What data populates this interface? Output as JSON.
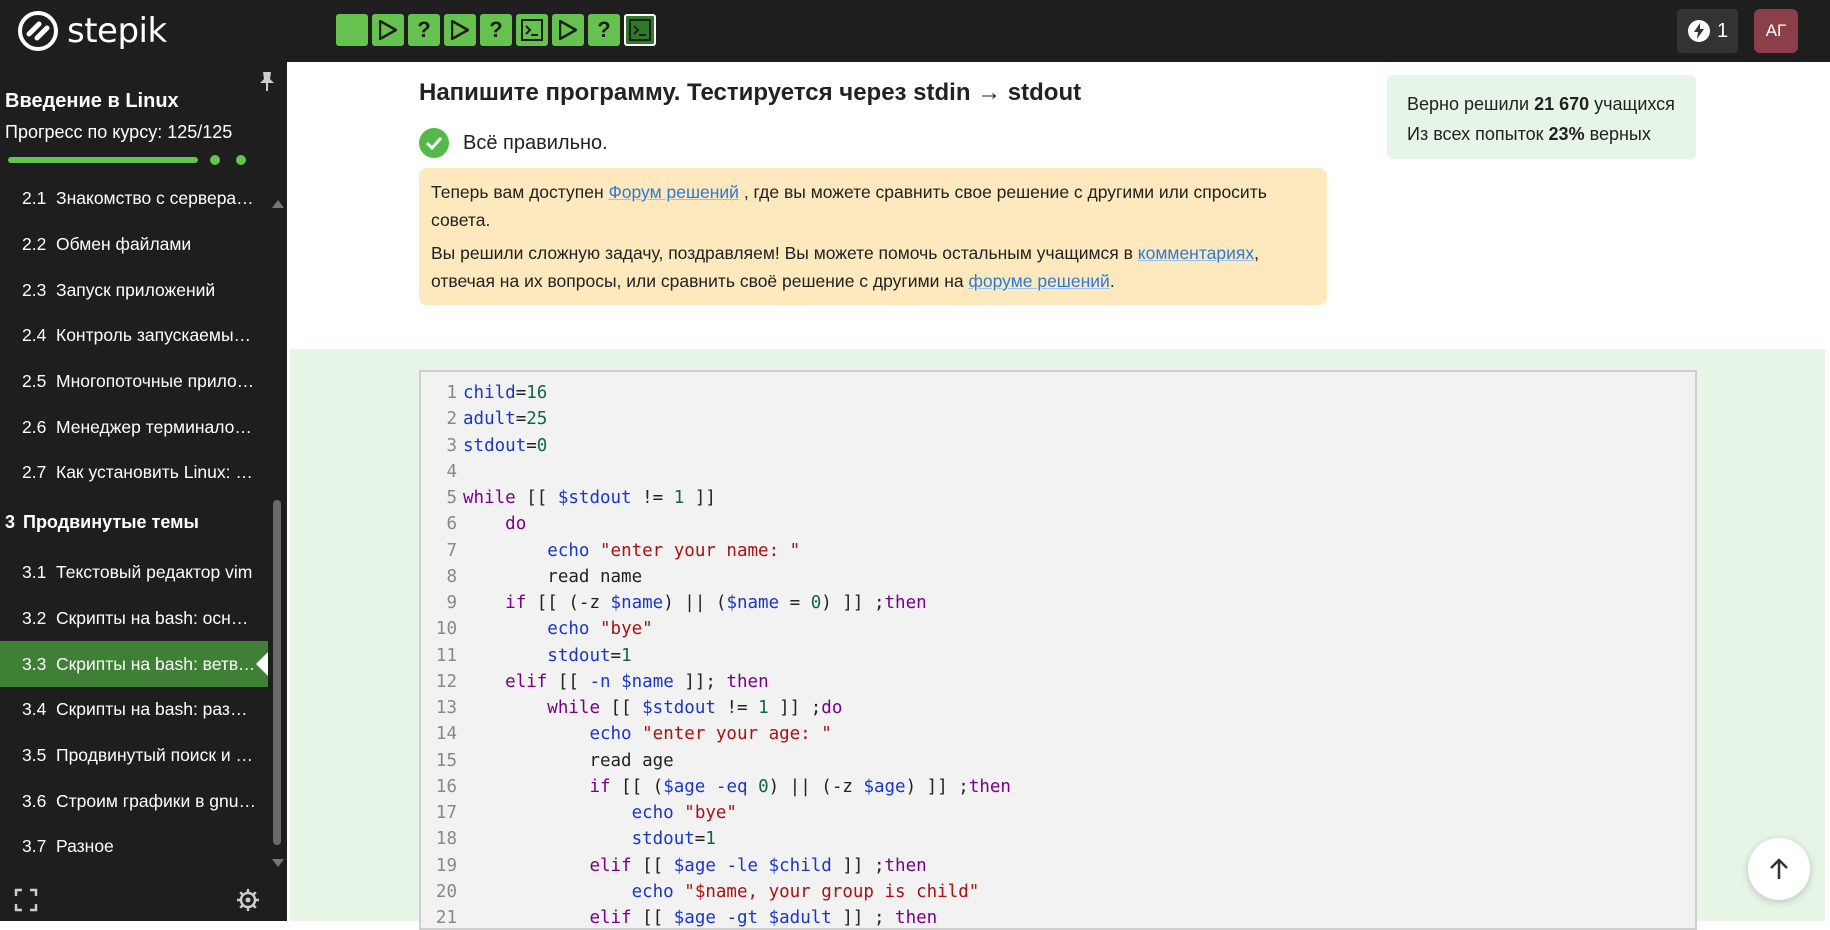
{
  "header": {
    "logo_text": "stepik",
    "steps": [
      {
        "type": "run",
        "icon": "play-icon"
      },
      {
        "type": "run",
        "icon": "play-icon"
      },
      {
        "type": "quiz",
        "label": "?"
      },
      {
        "type": "run",
        "icon": "play-icon"
      },
      {
        "type": "quiz",
        "label": "?"
      },
      {
        "type": "code",
        "icon": "terminal-icon"
      },
      {
        "type": "run",
        "icon": "play-icon"
      },
      {
        "type": "quiz",
        "label": "?"
      },
      {
        "type": "code",
        "icon": "terminal-icon",
        "current": true
      }
    ],
    "energy_count": "1",
    "avatar_initials": "АГ",
    "colors": {
      "step": "#66c24e",
      "step_current": "#2f7a26",
      "avatar": "#8b4049"
    }
  },
  "sidebar": {
    "course_title": "Введение в Linux",
    "progress_label": "Прогресс по курсу:  125/125",
    "progress_fraction": 1.0,
    "lessons": [
      {
        "num": "2.1",
        "name": "Знакомство с серверами"
      },
      {
        "num": "2.2",
        "name": "Обмен файлами"
      },
      {
        "num": "2.3",
        "name": "Запуск приложений"
      },
      {
        "num": "2.4",
        "name": "Контроль запускаемых процессов"
      },
      {
        "num": "2.5",
        "name": "Многопоточные приложения"
      },
      {
        "num": "2.6",
        "name": "Менеджер терминалов tmux"
      },
      {
        "num": "2.7",
        "name": "Как установить Linux: настоящее"
      },
      {
        "num": "3",
        "name": "Продвинутые темы",
        "section": true
      },
      {
        "num": "3.1",
        "name": "Текстовый редактор vim"
      },
      {
        "num": "3.2",
        "name": "Скрипты на bash: основы"
      },
      {
        "num": "3.3",
        "name": "Скрипты на bash: ветвления и циклы",
        "active": true
      },
      {
        "num": "3.4",
        "name": "Скрипты на bash: разное"
      },
      {
        "num": "3.5",
        "name": "Продвинутый поиск и редактирование"
      },
      {
        "num": "3.6",
        "name": "Строим графики в gnuplot"
      },
      {
        "num": "3.7",
        "name": "Разное"
      }
    ],
    "active_color": "#3f7f36"
  },
  "main": {
    "task_title": "Напишите программу. Тестируется через stdin → stdout",
    "status_text": "Всё правильно.",
    "notice1": {
      "before": "Теперь вам доступен ",
      "link": "Форум решений",
      "after": " , где вы можете сравнить свое решение с другими или спросить совета."
    },
    "notice2": {
      "before": "Вы решили сложную задачу, поздравляем! Вы можете помочь остальным учащимся в ",
      "link1": "комментариях",
      "middle": ", отвечая на их вопросы, или сравнить своё решение с другими на ",
      "link2": "форуме решений",
      "after": "."
    },
    "stats": {
      "solved_prefix": "Верно решили ",
      "solved_count": "21 670",
      "solved_suffix": " учащихся",
      "attempts_prefix": "Из всех попыток ",
      "attempts_percent": "23%",
      "attempts_suffix": " верных"
    }
  },
  "editor": {
    "language": "bash",
    "lines": [
      "child=16",
      "adult=25",
      "stdout=0",
      "",
      "while [[ $stdout != 1 ]]",
      "    do",
      "        echo \"enter your name: \"",
      "        read name",
      "    if [[ (-z $name) || ($name = 0) ]] ;then",
      "        echo \"bye\"",
      "        stdout=1",
      "    elif [[ -n $name ]]; then",
      "        while [[ $stdout != 1 ]] ;do",
      "            echo \"enter your age: \"",
      "            read age",
      "            if [[ ($age -eq 0) || (-z $age) ]] ;then",
      "                echo \"bye\"",
      "                stdout=1",
      "            elif [[ $age -le $child ]] ;then",
      "                echo \"$name, your group is child\"",
      "            elif [[ $age -gt $adult ]] ; then"
    ]
  }
}
